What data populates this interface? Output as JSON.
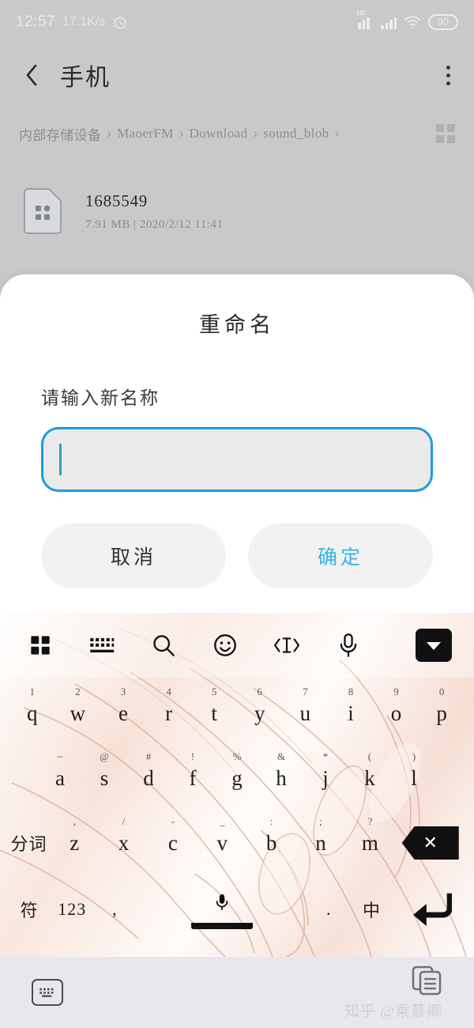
{
  "status_bar": {
    "time": "12:57",
    "network_speed": "17.1K/s",
    "alarm_icon": "alarm-clock-icon",
    "hd_label": "HD",
    "signal_icon": "signal-bars-icon",
    "signal2_icon": "signal-bars-icon",
    "wifi_icon": "wifi-icon",
    "battery_level": "90"
  },
  "app_bar": {
    "back_icon": "chevron-left-icon",
    "title": "手机",
    "menu_icon": "overflow-menu-icon"
  },
  "breadcrumb": {
    "separator": "›",
    "items": [
      {
        "label": "内部存储设备"
      },
      {
        "label": "MaoerFM"
      },
      {
        "label": "Download"
      },
      {
        "label": "sound_blob"
      }
    ],
    "view_toggle_icon": "grid-view-icon"
  },
  "file_list": {
    "items": [
      {
        "icon": "file-document-icon",
        "name": "1685549",
        "size": "7.91 MB",
        "separator": "|",
        "date": "2020/2/12 11:41",
        "subtitle": "7.91 MB  |  2020/2/12 11:41"
      }
    ]
  },
  "dialog": {
    "title": "重命名",
    "field_label": "请输入新名称",
    "input_value": "",
    "input_placeholder": "",
    "cancel_label": "取消",
    "confirm_label": "确定",
    "accent_color": "#1f9ae0",
    "confirm_color": "#3ab0e8",
    "caret_color": "#2aa3c4"
  },
  "keyboard": {
    "toolbar": [
      {
        "icon": "apps-grid-icon",
        "name": "keyboard-apps"
      },
      {
        "icon": "keyboard-icon",
        "name": "keyboard-layout"
      },
      {
        "icon": "search-icon",
        "name": "keyboard-search"
      },
      {
        "icon": "emoji-icon",
        "name": "keyboard-emoji"
      },
      {
        "icon": "cursor-move-icon",
        "name": "keyboard-cursor"
      },
      {
        "icon": "microphone-icon",
        "name": "keyboard-voice"
      }
    ],
    "collapse_icon": "caret-down-icon",
    "row1": [
      {
        "sup": "1",
        "main": "q"
      },
      {
        "sup": "2",
        "main": "w"
      },
      {
        "sup": "3",
        "main": "e"
      },
      {
        "sup": "4",
        "main": "r"
      },
      {
        "sup": "5",
        "main": "t"
      },
      {
        "sup": "6",
        "main": "y"
      },
      {
        "sup": "7",
        "main": "u"
      },
      {
        "sup": "8",
        "main": "i"
      },
      {
        "sup": "9",
        "main": "o"
      },
      {
        "sup": "0",
        "main": "p"
      }
    ],
    "row2": [
      {
        "sup": "~",
        "main": "a"
      },
      {
        "sup": "@",
        "main": "s"
      },
      {
        "sup": "#",
        "main": "d"
      },
      {
        "sup": "!",
        "main": "f"
      },
      {
        "sup": "%",
        "main": "g"
      },
      {
        "sup": "&",
        "main": "h"
      },
      {
        "sup": "*",
        "main": "j"
      },
      {
        "sup": "(",
        "main": "k"
      },
      {
        "sup": ")",
        "main": "l"
      }
    ],
    "row3": {
      "func_left": "分词",
      "keys": [
        {
          "sup": ",",
          "main": "z"
        },
        {
          "sup": "/",
          "main": "x"
        },
        {
          "sup": "-",
          "main": "c"
        },
        {
          "sup": "_",
          "main": "v"
        },
        {
          "sup": ":",
          "main": "b"
        },
        {
          "sup": ";",
          "main": "n"
        },
        {
          "sup": "?",
          "main": "m"
        }
      ],
      "backspace_icon": "backspace-icon",
      "backspace_glyph": "✕"
    },
    "row4": {
      "symbol_key": "符",
      "numeric_key": "123",
      "comma_key": ",",
      "space_icon": "microphone-icon",
      "period_key": ".",
      "language_key": "中",
      "enter_icon": "enter-arrow-icon"
    }
  },
  "nav_bar": {
    "keyboard_icon": "keyboard-hide-icon",
    "recents_icon": "recent-apps-icon"
  },
  "watermark": {
    "text": "知乎 @乘慕卿"
  }
}
